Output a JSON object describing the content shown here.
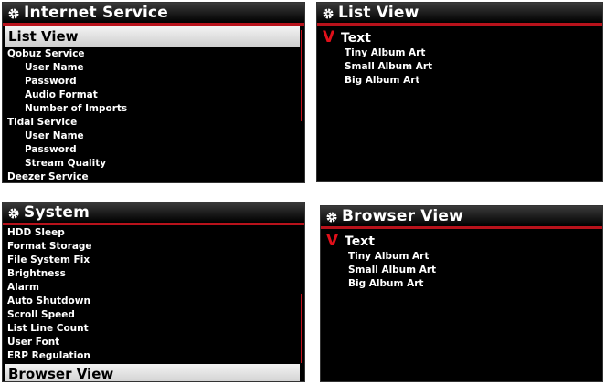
{
  "panels": {
    "internet": {
      "title": "Internet Service",
      "selected": "List View",
      "items": [
        {
          "label": "Qobuz Service",
          "indent": false
        },
        {
          "label": "User Name",
          "indent": true
        },
        {
          "label": "Password",
          "indent": true
        },
        {
          "label": "Audio Format",
          "indent": true
        },
        {
          "label": "Number of Imports",
          "indent": true
        },
        {
          "label": "Tidal Service",
          "indent": false
        },
        {
          "label": "User Name",
          "indent": true
        },
        {
          "label": "Password",
          "indent": true
        },
        {
          "label": "Stream Quality",
          "indent": true
        },
        {
          "label": "Deezer Service",
          "indent": false
        }
      ]
    },
    "listview": {
      "title": "List View",
      "checked": "Text",
      "options": [
        "Tiny Album Art",
        "Small Album Art",
        "Big Album Art"
      ]
    },
    "system": {
      "title": "System",
      "items": [
        "HDD Sleep",
        "Format Storage",
        "File System Fix",
        "Brightness",
        "Alarm",
        "Auto Shutdown",
        "Scroll Speed",
        "List Line Count",
        "User Font",
        "ERP Regulation"
      ],
      "selected": "Browser View"
    },
    "browserview": {
      "title": "Browser View",
      "checked": "Text",
      "options": [
        "Tiny Album Art",
        "Small Album Art",
        "Big Album Art"
      ]
    }
  },
  "check_mark": "V",
  "icons": {
    "title": "gear-icon"
  },
  "colors": {
    "accent": "#b8121b",
    "check": "#e0101a",
    "background": "#000000",
    "selection": "#dcdcdc"
  }
}
